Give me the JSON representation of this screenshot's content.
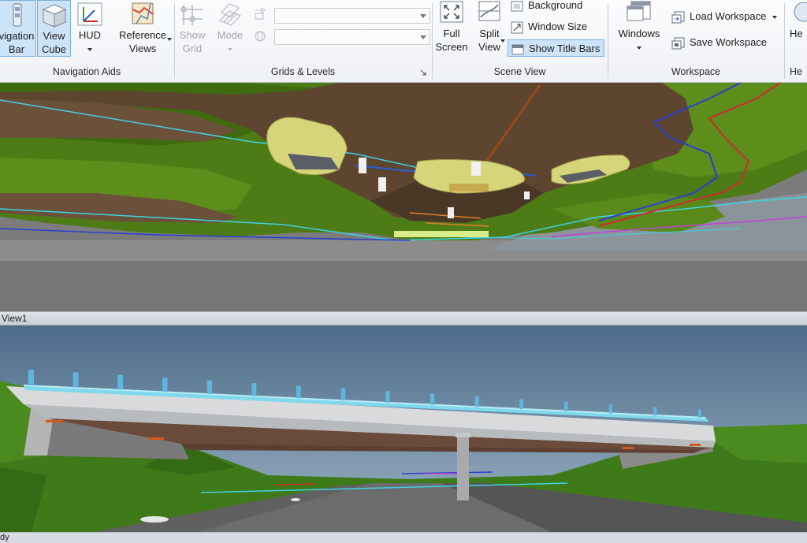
{
  "ribbon": {
    "groups": {
      "navigation_aids": "Navigation Aids",
      "grids_levels": "Grids & Levels",
      "scene_view": "Scene View",
      "workspace": "Workspace"
    },
    "nav_bar": [
      "vigation",
      "Bar"
    ],
    "view_cube": [
      "View",
      "Cube"
    ],
    "hud": "HUD",
    "reference_views": [
      "Reference",
      "Views"
    ],
    "show_grid": [
      "Show",
      "Grid"
    ],
    "mode": "Mode",
    "full_screen": [
      "Full",
      "Screen"
    ],
    "split_view": [
      "Split",
      "View"
    ],
    "background": "Background",
    "window_size": "Window Size",
    "show_title_bars": "Show Title Bars",
    "windows": "Windows",
    "load_workspace": "Load Workspace",
    "save_workspace": "Save Workspace",
    "help_partial": "He",
    "help_group_partial": "He"
  },
  "views": {
    "bottom_view_title": "View1"
  },
  "status": {
    "text": "dy"
  },
  "colors": {
    "ribbon_bg": "#f3f5f8",
    "active_tool": "#cde3f7",
    "sky": "#6d89a3",
    "terrain": "#4f7f18",
    "deck": "#c9ccce"
  }
}
